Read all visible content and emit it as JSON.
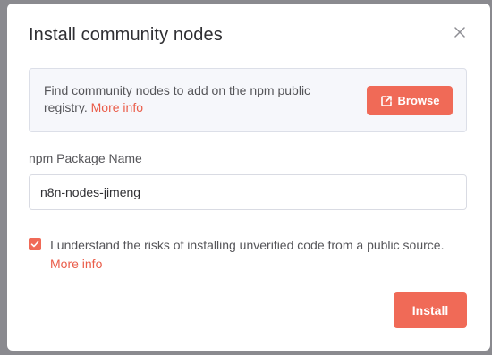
{
  "dialog": {
    "title": "Install community nodes",
    "close_icon": "close-icon"
  },
  "info": {
    "text": "Find community nodes to add on the npm public registry.",
    "more_info": "More info",
    "browse_label": "Browse",
    "browse_icon": "external-link-icon"
  },
  "package": {
    "label": "npm Package Name",
    "value": "n8n-nodes-jimeng"
  },
  "consent": {
    "checked": true,
    "text": "I understand the risks of installing unverified code from a public source.",
    "more_info": "More info"
  },
  "install_label": "Install",
  "colors": {
    "accent": "#f06a57",
    "link": "#ea5d4a",
    "overlay": "#8a8a8f"
  }
}
